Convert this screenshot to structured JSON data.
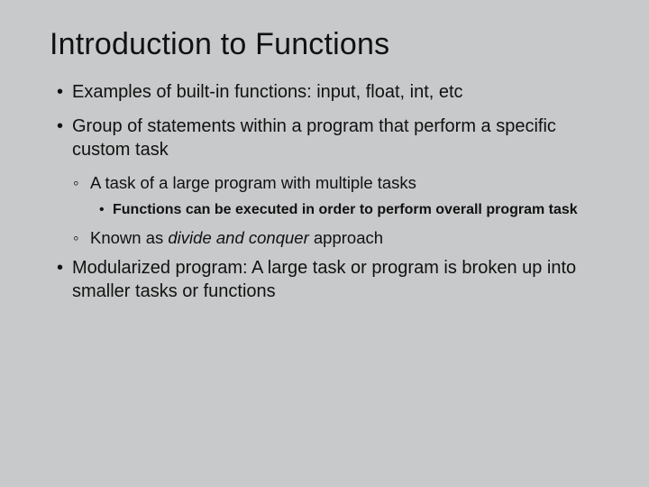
{
  "slide": {
    "title": "Introduction to Functions",
    "bullets": {
      "b1_1": "Examples of built-in functions: input, float, int, etc",
      "b1_2": "Group of statements within a program that perform a specific custom task",
      "b2_1": "A task of a large program with multiple tasks",
      "b3_1": "Functions can be executed in order to perform overall program task",
      "b2_2_pre": "Known as ",
      "b2_2_italic": "divide and conquer",
      "b2_2_post": " approach",
      "b1_3": "Modularized program: A large task or program is broken up into smaller tasks or functions"
    },
    "markers": {
      "dot": "•",
      "ring": "◦"
    }
  }
}
